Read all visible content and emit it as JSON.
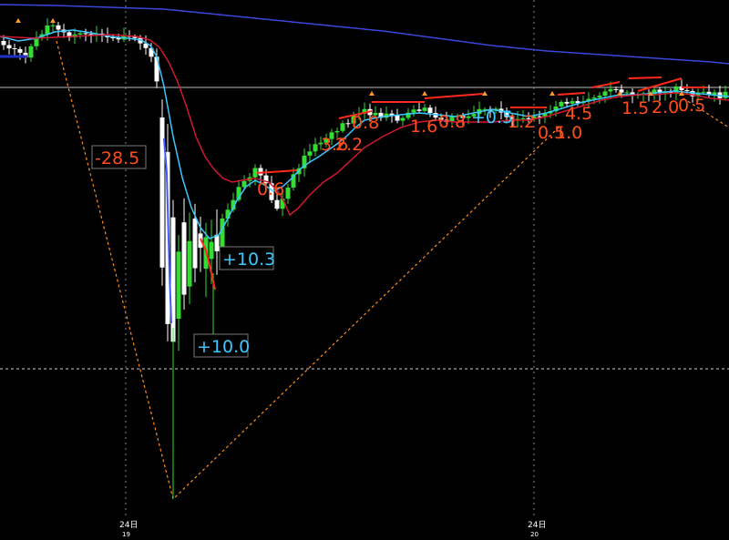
{
  "chart_data": {
    "type": "candlestick",
    "title": "",
    "x_labels": [
      {
        "text": "24日",
        "sub": "19"
      },
      {
        "text": "24日",
        "sub": "20"
      }
    ],
    "annotations": [
      {
        "text": "-28.5",
        "color": "#ff4d1a",
        "boxed": true,
        "kind": "swing-down"
      },
      {
        "text": "+10.3",
        "color": "#3cc8ff",
        "boxed": true,
        "kind": "swing-up"
      },
      {
        "text": "+10.0",
        "color": "#3cc8ff",
        "boxed": true,
        "kind": "swing-up"
      },
      {
        "text": "3.6",
        "color": "#ff4d1a",
        "boxed": false
      },
      {
        "text": "2.2",
        "color": "#ff4d1a",
        "boxed": false
      },
      {
        "text": "0.6",
        "color": "#ff4d1a",
        "boxed": false
      },
      {
        "text": "0.8",
        "color": "#ff4d1a",
        "boxed": false
      },
      {
        "text": "1.6",
        "color": "#ff4d1a",
        "boxed": false
      },
      {
        "text": "0.8",
        "color": "#ff4d1a",
        "boxed": false
      },
      {
        "text": "+0.5",
        "color": "#3cc8ff",
        "boxed": false
      },
      {
        "text": "1.2",
        "color": "#ff4d1a",
        "boxed": false
      },
      {
        "text": "0.5",
        "color": "#ff4d1a",
        "boxed": false
      },
      {
        "text": "1.0",
        "color": "#ff4d1a",
        "boxed": false
      },
      {
        "text": "4.5",
        "color": "#ff4d1a",
        "boxed": false
      },
      {
        "text": "1.5",
        "color": "#ff4d1a",
        "boxed": false
      },
      {
        "text": "2.0",
        "color": "#ff4d1a",
        "boxed": false
      },
      {
        "text": "0.5",
        "color": "#ff4d1a",
        "boxed": false
      }
    ],
    "series": [
      {
        "name": "",
        "kind": "moving-average",
        "color": "#3cc8ff"
      },
      {
        "name": "",
        "kind": "moving-average",
        "color": "#d01830"
      },
      {
        "name": "",
        "kind": "moving-average",
        "color": "#3848d8"
      }
    ],
    "grid": false,
    "colors": {
      "up": "#33dd33",
      "down": "#ffffff",
      "swing_line": "#ff8c1a",
      "upper_level": "#bbbbbb"
    }
  }
}
